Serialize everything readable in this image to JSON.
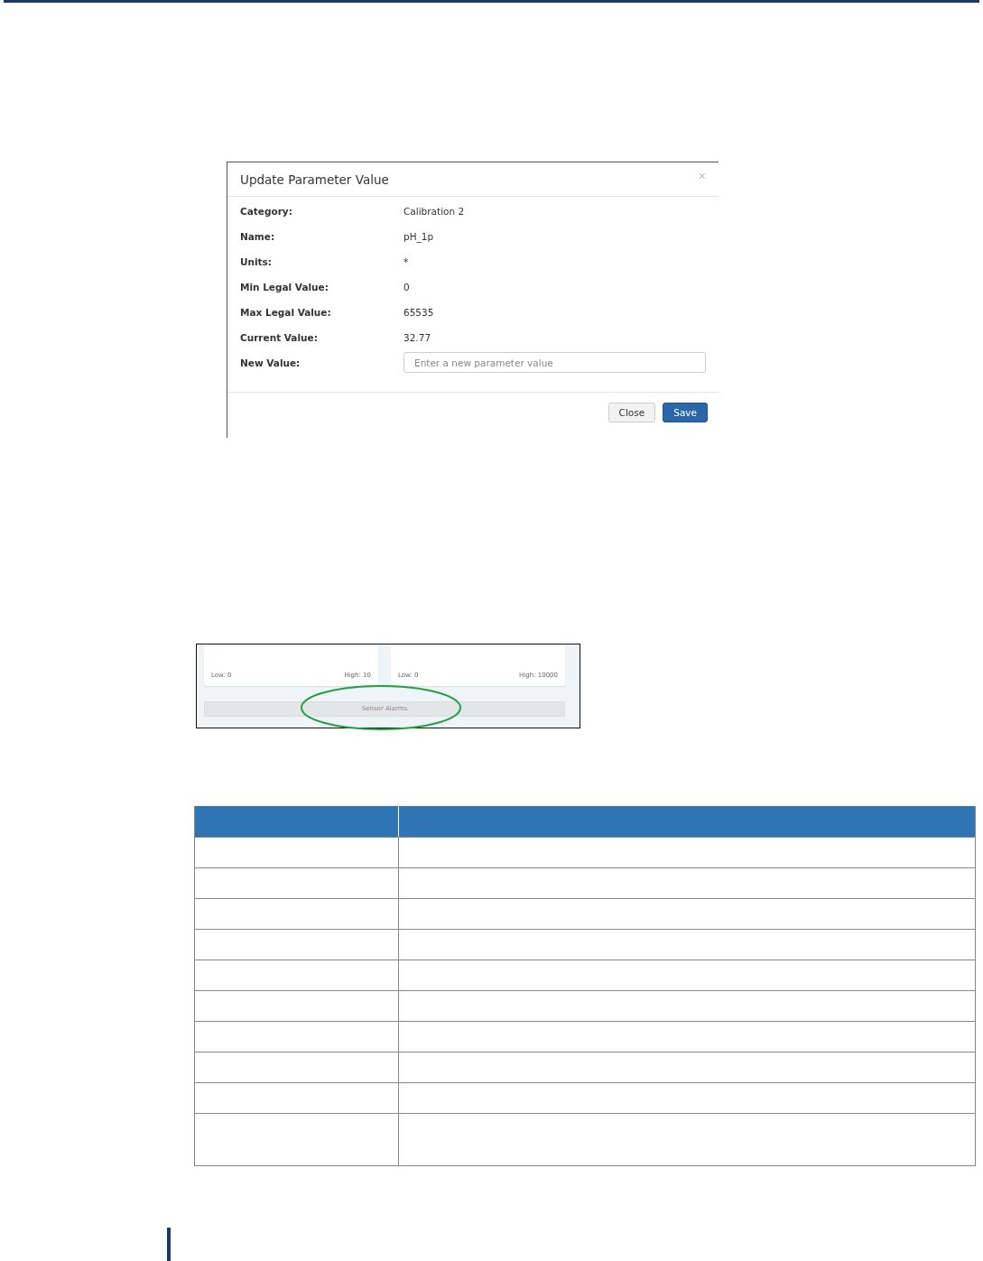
{
  "dialog": {
    "title": "Update Parameter Value",
    "close_glyph": "×",
    "fields": [
      {
        "label": "Category:",
        "value": "Calibration 2"
      },
      {
        "label": "Name:",
        "value": "pH_1p"
      },
      {
        "label": "Units:",
        "value": "*"
      },
      {
        "label": "Min Legal Value:",
        "value": "0"
      },
      {
        "label": "Max Legal Value:",
        "value": "65535"
      },
      {
        "label": "Current Value:",
        "value": "32.77"
      }
    ],
    "input": {
      "label": "New Value:",
      "placeholder": "Enter a new parameter value"
    },
    "buttons": [
      {
        "label": "Close",
        "kind": "default"
      },
      {
        "label": "Save",
        "kind": "primary"
      }
    ]
  },
  "sensor_panel": {
    "cards": [
      {
        "low": "Low: 0",
        "high": "High: 10"
      },
      {
        "low": "Low: 0",
        "high": "High: 10000"
      }
    ],
    "alarms_button": "Sensor Alarms"
  }
}
